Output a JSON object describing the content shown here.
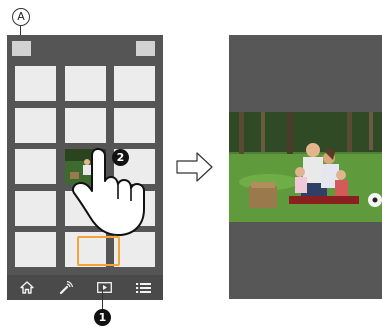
{
  "callouts": {
    "a_label": "A",
    "one_label": "1",
    "two_label": "2"
  },
  "phone": {
    "grid": {
      "rows": 5,
      "cols": 3,
      "selected_row": 2,
      "selected_col": 1
    },
    "bottom_bar": [
      "home-icon",
      "remote-icon",
      "playback-icon",
      "menu-icon"
    ],
    "active_tab": "playback-icon",
    "highlight_color": "#f2a43a"
  },
  "colors": {
    "screen_bg": "#555555",
    "tile": "#ececec",
    "bar": "#4a4a4a"
  }
}
